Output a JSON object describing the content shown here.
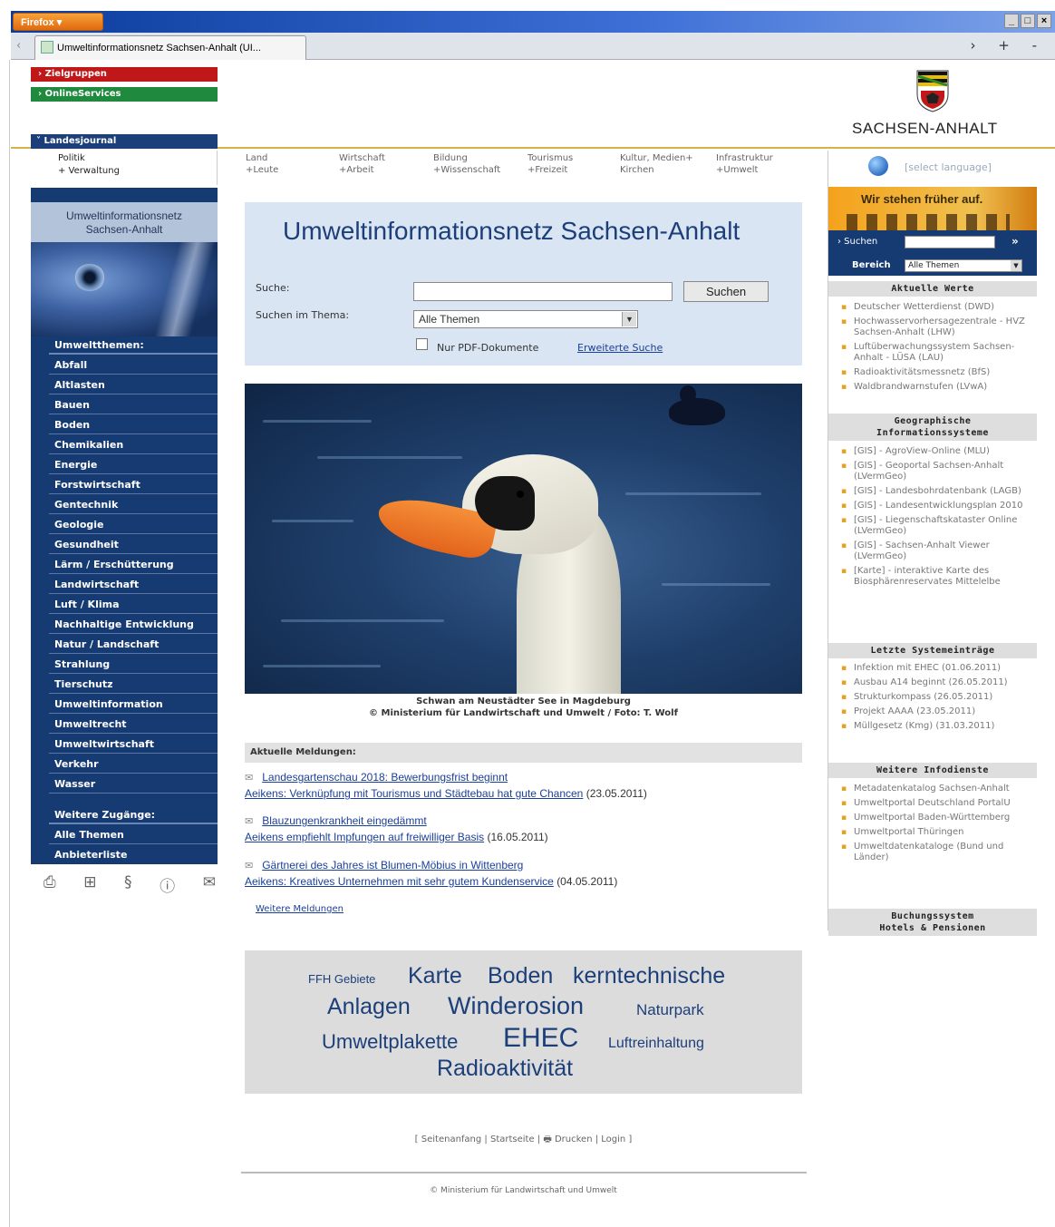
{
  "browser": {
    "app_button": "Firefox ▾",
    "window_controls": [
      "_",
      "□",
      "×"
    ],
    "tab_title": "Umweltinformationsnetz Sachsen-Anhalt (UI...",
    "tab_actions": "› + -"
  },
  "top_menus": {
    "zielgruppen": "› Zielgruppen",
    "onlineservices": "› OnlineServices"
  },
  "brand": {
    "name": "SACHSEN-ANHALT"
  },
  "landesjournal": {
    "title": "Landesjournal",
    "line1": "Politik",
    "line2": "+ Verwaltung"
  },
  "left_panel": {
    "title_line1": "Umweltinformationsnetz",
    "title_line2": "Sachsen-Anhalt",
    "nav_heading": "Umweltthemen:",
    "nav_items": [
      "Abfall",
      "Altlasten",
      "Bauen",
      "Boden",
      "Chemikalien",
      "Energie",
      "Forstwirtschaft",
      "Gentechnik",
      "Geologie",
      "Gesundheit",
      "Lärm / Erschütterung",
      "Landwirtschaft",
      "Luft / Klima",
      "Nachhaltige Entwicklung",
      "Natur / Landschaft",
      "Strahlung",
      "Tierschutz",
      "Umweltinformation",
      "Umweltrecht",
      "Umweltwirtschaft",
      "Verkehr",
      "Wasser"
    ],
    "other_heading": "Weitere Zugänge:",
    "other_items": [
      "Alle Themen",
      "Anbieterliste"
    ]
  },
  "util_icons": [
    "print-icon",
    "sitemap-icon",
    "paragraph-icon",
    "help-icon",
    "mail-icon"
  ],
  "topnav": [
    {
      "l1": "Land",
      "l2": "+Leute"
    },
    {
      "l1": "Wirtschaft",
      "l2": "+Arbeit"
    },
    {
      "l1": "Bildung",
      "l2": "+Wissenschaft"
    },
    {
      "l1": "Tourismus",
      "l2": "+Freizeit"
    },
    {
      "l1": "Kultur, Medien+",
      "l2": "Kirchen"
    },
    {
      "l1": "Infrastruktur",
      "l2": "+Umwelt"
    }
  ],
  "search": {
    "title": "Umweltinformationsnetz Sachsen-Anhalt",
    "label_query": "Suche:",
    "query_value": "",
    "button": "Suchen",
    "label_theme": "Suchen im Thema:",
    "theme_value": "Alle Themen",
    "pdf_only_label": "Nur PDF-Dokumente",
    "advanced_link": "Erweiterte Suche"
  },
  "photo": {
    "caption1": "Schwan am Neustädter See in Magdeburg",
    "caption2": "© Ministerium für Landwirtschaft und Umwelt / Foto: T. Wolf"
  },
  "news": {
    "heading": "Aktuelle Meldungen:",
    "items": [
      {
        "title": "Landesgartenschau 2018: Bewerbungsfrist beginnt",
        "sub": "Aeikens: Verknüpfung mit Tourismus und Städtebau hat gute Chancen",
        "date": "(23.05.2011)"
      },
      {
        "title": "Blauzungenkrankheit eingedämmt",
        "sub": "Aeikens empfiehlt Impfungen auf freiwilliger Basis",
        "date": "(16.05.2011)"
      },
      {
        "title": "Gärtnerei des Jahres ist Blumen-Möbius in Wittenberg",
        "sub": "Aeikens: Kreatives Unternehmen mit sehr gutem Kundenservice",
        "date": "(04.05.2011)"
      }
    ],
    "more": "Weitere Meldungen"
  },
  "tags": [
    "FFH Gebiete",
    "Karte",
    "Boden",
    "kerntechnische",
    "Anlagen",
    "Winderosion",
    "Naturpark",
    "Umweltplakette",
    "EHEC",
    "Luftreinhaltung",
    "Radioaktivität"
  ],
  "footer": {
    "links": "[ Seitenanfang | Startseite | 🖶 Drucken | Login ]",
    "copyright": "© Ministerium für Landwirtschaft und Umwelt"
  },
  "right": {
    "language": "[select language]",
    "banner_text": "Wir stehen früher auf.",
    "search_label": "› Suchen",
    "search_go": "»",
    "area_label": "Bereich",
    "area_value": "Alle Themen",
    "box1_title": "Aktuelle Werte",
    "box1_items": [
      "Deutscher Wetterdienst (DWD)",
      "Hochwasservorhersagezentrale - HVZ Sachsen-Anhalt (LHW)",
      "Luftüberwachungssystem Sachsen-Anhalt - LÜSA (LAU)",
      "Radioaktivitätsmessnetz (BfS)",
      "Waldbrandwarnstufen (LVwA)"
    ],
    "box2_title_1": "Geographische",
    "box2_title_2": "Informationssysteme",
    "box2_items": [
      "[GIS] - AgroView-Online (MLU)",
      "[GIS] - Geoportal Sachsen-Anhalt (LVermGeo)",
      "[GIS] - Landesbohrdatenbank (LAGB)",
      "[GIS] - Landesentwicklungsplan 2010",
      "[GIS] - Liegenschaftskataster Online (LVermGeo)",
      "[GIS] - Sachsen-Anhalt Viewer (LVermGeo)",
      "[Karte] - interaktive Karte des Biosphärenreservates Mittelelbe"
    ],
    "box3_title": "Letzte Systemeinträge",
    "box3_items": [
      "Infektion mit EHEC (01.06.2011)",
      "Ausbau A14 beginnt (26.05.2011)",
      "Strukturkompass (26.05.2011)",
      "Projekt AAAA (23.05.2011)",
      "Müllgesetz (Kmg) (31.03.2011)"
    ],
    "box4_title": "Weitere Infodienste",
    "box4_items": [
      "Metadatenkatalog Sachsen-Anhalt",
      "Umweltportal Deutschland PortalU",
      "Umweltportal Baden-Württemberg",
      "Umweltportal Thüringen",
      "Umweltdatenkataloge (Bund und Länder)"
    ],
    "box5_title_1": "Buchungssystem",
    "box5_title_2": "Hotels & Pensionen"
  }
}
